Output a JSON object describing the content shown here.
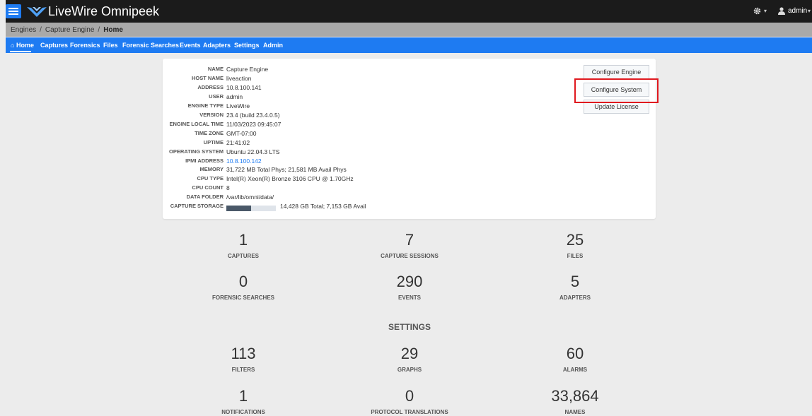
{
  "header": {
    "app_title": "LiveWire Omnipeek",
    "user_label": "admin",
    "icons": [
      "menu-icon",
      "livewire-logo-icon",
      "gear-icon",
      "user-icon"
    ],
    "colors": {
      "header_bg": "#1b1b1b",
      "nav_bg": "#1e7bf2",
      "highlight": "#e0191f"
    }
  },
  "breadcrumb": [
    "Engines",
    "Capture Engine",
    "Home"
  ],
  "nav": [
    "Home",
    "Captures",
    "Forensics",
    "Files",
    "Forensic Searches",
    "Events",
    "Adapters",
    "Settings",
    "Admin"
  ],
  "engine_info": [
    {
      "label": "NAME",
      "value": "Capture Engine"
    },
    {
      "label": "HOST NAME",
      "value": "liveaction"
    },
    {
      "label": "ADDRESS",
      "value": "10.8.100.141"
    },
    {
      "label": "USER",
      "value": "admin"
    },
    {
      "label": "ENGINE TYPE",
      "value": "LiveWire"
    },
    {
      "label": "VERSION",
      "value": "23.4 (build 23.4.0.5)"
    },
    {
      "label": "ENGINE LOCAL TIME",
      "value": "11/03/2023 09:45:07"
    },
    {
      "label": "TIME ZONE",
      "value": "GMT-07:00"
    },
    {
      "label": "UPTIME",
      "value": "21:41:02"
    },
    {
      "label": "OPERATING SYSTEM",
      "value": "Ubuntu 22.04.3 LTS"
    },
    {
      "label": "IPMI ADDRESS",
      "value": "10.8.100.142"
    },
    {
      "label": "MEMORY",
      "value": "31,722 MB Total Phys; 21,581 MB Avail Phys"
    },
    {
      "label": "CPU TYPE",
      "value": "Intel(R) Xeon(R) Bronze 3106 CPU @ 1.70GHz"
    },
    {
      "label": "CPU COUNT",
      "value": "8"
    },
    {
      "label": "DATA FOLDER",
      "value": "/var/lib/omni/data/"
    },
    {
      "label": "CAPTURE STORAGE",
      "value": "14,428 GB Total; 7,153 GB Avail"
    }
  ],
  "storage_used_fraction": 0.504,
  "buttons": [
    "Configure Engine",
    "Configure System",
    "Update License"
  ],
  "stats": [
    {
      "value": "1",
      "label": "CAPTURES"
    },
    {
      "value": "7",
      "label": "CAPTURE SESSIONS"
    },
    {
      "value": "25",
      "label": "FILES"
    },
    {
      "value": "0",
      "label": "FORENSIC SEARCHES"
    },
    {
      "value": "290",
      "label": "EVENTS"
    },
    {
      "value": "5",
      "label": "ADAPTERS"
    }
  ],
  "settings_title": "SETTINGS",
  "settings_stats": [
    {
      "value": "113",
      "label": "FILTERS"
    },
    {
      "value": "29",
      "label": "GRAPHS"
    },
    {
      "value": "60",
      "label": "ALARMS"
    },
    {
      "value": "1",
      "label": "NOTIFICATIONS"
    },
    {
      "value": "0",
      "label": "PROTOCOL TRANSLATIONS"
    },
    {
      "value": "33,864",
      "label": "NAMES"
    }
  ]
}
